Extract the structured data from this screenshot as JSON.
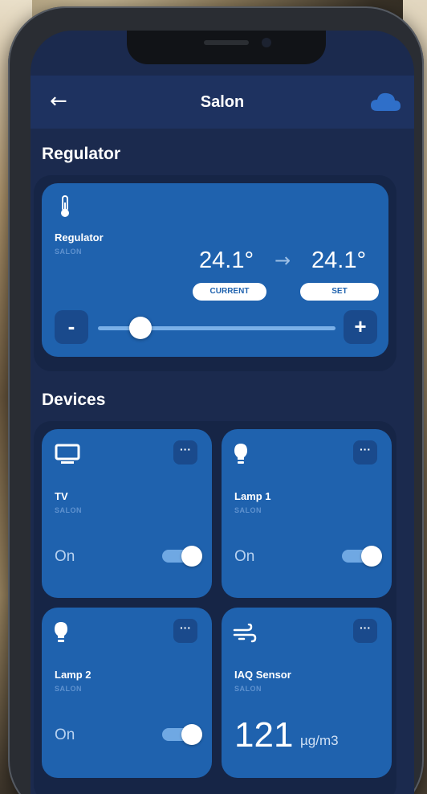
{
  "header": {
    "back_icon": "arrow-left-icon",
    "title": "Salon",
    "cloud_icon": "cloud-icon"
  },
  "regulator_section": {
    "title": "Regulator",
    "card": {
      "icon": "thermometer-icon",
      "name": "Regulator",
      "room": "SALON",
      "current_temp": "24.1°",
      "set_temp": "24.1°",
      "current_label": "CURRENT",
      "set_label": "SET",
      "minus_label": "-",
      "plus_label": "+",
      "slider_level": 0.18
    }
  },
  "devices_section": {
    "title": "Devices",
    "devices": [
      {
        "name": "TV",
        "room": "SALON",
        "icon": "tv-icon",
        "state": "On",
        "toggle_on": true,
        "more": "···"
      },
      {
        "name": "Lamp 1",
        "room": "SALON",
        "icon": "lightbulb-icon",
        "state": "On",
        "toggle_on": true,
        "more": "···"
      },
      {
        "name": "Lamp 2",
        "room": "SALON",
        "icon": "lightbulb-icon",
        "state": "On",
        "toggle_on": true,
        "more": "···"
      },
      {
        "name": "IAQ Sensor",
        "room": "SALON",
        "icon": "wind-icon",
        "value": "121",
        "unit": "µg/m3",
        "more": "···"
      }
    ]
  },
  "colors": {
    "screen_bg": "#1b2a4e",
    "card_bg": "#1f62ae",
    "accent_dark": "#1a4a8c"
  }
}
